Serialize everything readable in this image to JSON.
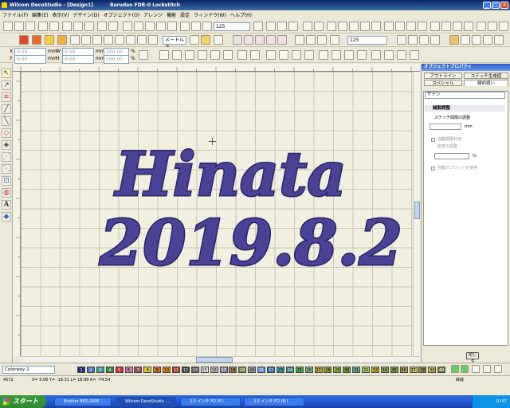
{
  "window": {
    "title": "Wilcom DecoStudio - [Design1]",
    "machine": "Barudan FDR-II Lockstitch"
  },
  "menu": [
    "ファイル(F)",
    "編集(E)",
    "表示(V)",
    "デザイン(D)",
    "オブジェクト(O)",
    "アレンジ",
    "機能",
    "設定",
    "ウィンドウ(W)",
    "ヘルプ(H)"
  ],
  "toolbar": {
    "size_value": "125",
    "zoom_value": "125",
    "font_name": "メートル法",
    "x_label": "X",
    "y_label": "Y",
    "w_label": "W",
    "h_label": "H",
    "x_value": "0.00",
    "y_value": "0.00",
    "w_value": "0.00",
    "h_value": "0.00",
    "unit": "mm",
    "w_pct": "100.00",
    "h_pct": "100.00",
    "pct": "%"
  },
  "design": {
    "line1": "Hinata",
    "line2": "2019.8.2",
    "thread_color": "#3c3580"
  },
  "panel": {
    "title": "オブジェクトプロパティ",
    "tabs": [
      "アウトライン",
      "ステッチ生成値",
      "スペシャル",
      "繰め縫い"
    ],
    "stitch_type": "サテン",
    "section": "縫製調整",
    "spacing_label": "ステッチ間隔の調整",
    "spacing_unit": "mm",
    "auto_spacing": "自動間隔利用",
    "density_label": "密度の調整",
    "pct_unit": "%",
    "auto_split": "自動スプリットを使用",
    "close_button": "閉じる"
  },
  "colorway": {
    "label": "Colorway 1",
    "swatches": [
      {
        "n": "1",
        "c": "#2a2a7a",
        "t": "#fff"
      },
      {
        "n": "2",
        "c": "#3f7cc4",
        "t": "#fff"
      },
      {
        "n": "3",
        "c": "#3aa0a0",
        "t": "#fff"
      },
      {
        "n": "4",
        "c": "#3c8a3c",
        "t": "#fff"
      },
      {
        "n": "5",
        "c": "#c03030",
        "t": "#fff"
      },
      {
        "n": "6",
        "c": "#d080b0",
        "t": "#000"
      },
      {
        "n": "7",
        "c": "#a05050",
        "t": "#fff"
      },
      {
        "n": "8",
        "c": "#e0d040",
        "t": "#000"
      },
      {
        "n": "9",
        "c": "#c87030",
        "t": "#000"
      },
      {
        "n": "10",
        "c": "#e08a20",
        "t": "#000"
      },
      {
        "n": "11",
        "c": "#b03a20",
        "t": "#fff"
      },
      {
        "n": "12",
        "c": "#3a3a3a",
        "t": "#fff"
      },
      {
        "n": "13",
        "c": "#5a5a70",
        "t": "#fff"
      },
      {
        "n": "15",
        "c": "#e8e8e8",
        "t": "#000"
      },
      {
        "n": "16",
        "c": "#c0c0c0",
        "t": "#000"
      },
      {
        "n": "17",
        "c": "#8080b0",
        "t": "#fff"
      },
      {
        "n": "18",
        "c": "#a08060",
        "t": "#000"
      },
      {
        "n": "19",
        "c": "#6a8a40",
        "t": "#fff"
      },
      {
        "n": "20",
        "c": "#a0a0a0",
        "t": "#000"
      },
      {
        "n": "21",
        "c": "#5090d0",
        "t": "#fff"
      },
      {
        "n": "22",
        "c": "#2a6ab0",
        "t": "#fff"
      },
      {
        "n": "23",
        "c": "#40a0c0",
        "t": "#000"
      },
      {
        "n": "24",
        "c": "#2a8a70",
        "t": "#fff"
      },
      {
        "n": "25",
        "c": "#50b050",
        "t": "#000"
      },
      {
        "n": "26",
        "c": "#80c080",
        "t": "#000"
      },
      {
        "n": "27",
        "c": "#c0a040",
        "t": "#000"
      },
      {
        "n": "28",
        "c": "#a0a030",
        "t": "#000"
      },
      {
        "n": "29",
        "c": "#90c040",
        "t": "#000"
      },
      {
        "n": "30",
        "c": "#6aa040",
        "t": "#000"
      },
      {
        "n": "31",
        "c": "#60b090",
        "t": "#000"
      },
      {
        "n": "32",
        "c": "#b0d060",
        "t": "#000"
      },
      {
        "n": "33",
        "c": "#c0b030",
        "t": "#000"
      },
      {
        "n": "34",
        "c": "#90b050",
        "t": "#000"
      },
      {
        "n": "35",
        "c": "#7aa050",
        "t": "#000"
      },
      {
        "n": "36",
        "c": "#b0a060",
        "t": "#000"
      },
      {
        "n": "37",
        "c": "#c0c060",
        "t": "#000"
      },
      {
        "n": "38",
        "c": "#a09040",
        "t": "#000"
      },
      {
        "n": "39",
        "c": "#d0c050",
        "t": "#000"
      },
      {
        "n": "40",
        "c": "#708030",
        "t": "#fff"
      }
    ]
  },
  "status": {
    "stitches": "4572",
    "coords": "X= 5.06  Y= -18.31  L= 18.99  A= -74.54",
    "mode": "繰縫"
  },
  "taskbar": {
    "start": "スタート",
    "tasks": [
      "Brother BES-200E -...",
      "Wilcom DecoStudio -...",
      "3.5 インチ FD (F:)",
      "3.5 インチ FD (B:)"
    ],
    "clock": "10:57"
  }
}
